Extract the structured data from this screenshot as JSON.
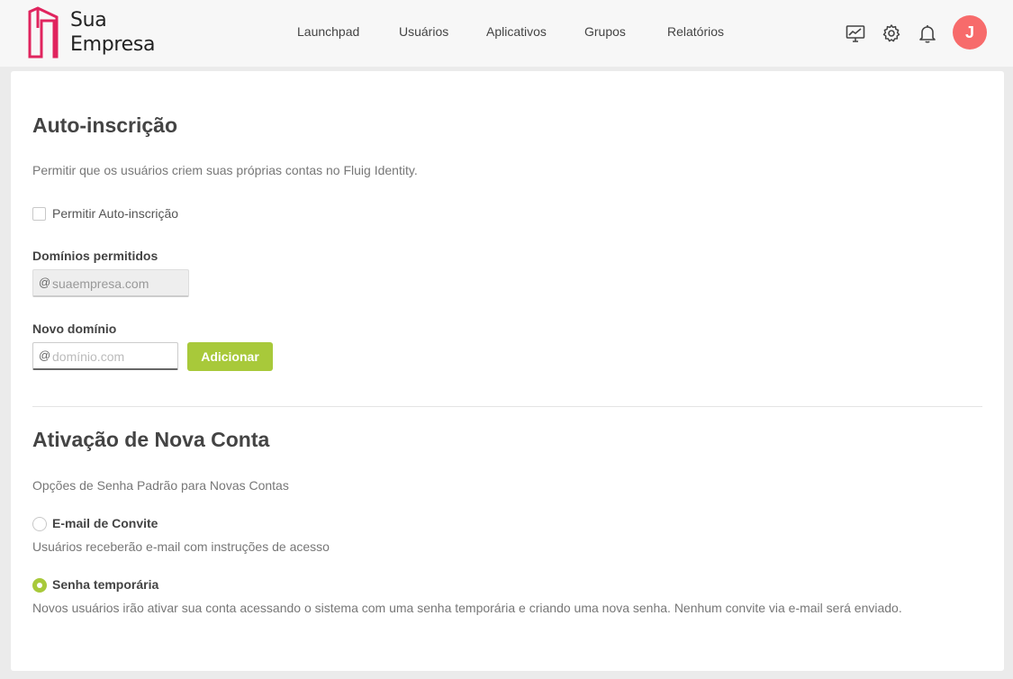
{
  "brand": {
    "line1": "Sua",
    "line2": "Empresa",
    "accent": "#e0245e"
  },
  "nav": {
    "items": [
      {
        "label": "Launchpad"
      },
      {
        "label": "Usuários"
      },
      {
        "label": "Aplicativos"
      },
      {
        "label": "Grupos"
      },
      {
        "label": "Relatórios"
      }
    ]
  },
  "header_icons": [
    "monitor-chart-icon",
    "gear-icon",
    "bell-icon"
  ],
  "user": {
    "initial": "J",
    "avatar_color": "#f76b6b"
  },
  "self_signup": {
    "title": "Auto-inscrição",
    "description": "Permitir que os usuários criem suas próprias contas no Fluig Identity.",
    "checkbox_label": "Permitir Auto-inscrição",
    "checkbox_checked": false,
    "allowed_domains_label": "Domínios permitidos",
    "allowed_domain_value": "suaempresa.com",
    "new_domain_label": "Novo domínio",
    "new_domain_placeholder": "domínio.com",
    "at_symbol": "@",
    "add_button": "Adicionar"
  },
  "activation": {
    "title": "Ativação de Nova Conta",
    "description": "Opções de Senha Padrão para Novas Contas",
    "options": [
      {
        "label": "E-mail de Convite",
        "description": "Usuários receberão e-mail com instruções de acesso",
        "selected": false
      },
      {
        "label": "Senha temporária",
        "description": "Novos usuários irão ativar sua conta acessando o sistema com uma senha temporária e criando uma nova senha. Nenhum convite via e-mail será enviado.",
        "selected": true
      }
    ]
  },
  "colors": {
    "accent_green": "#a8c93a"
  }
}
